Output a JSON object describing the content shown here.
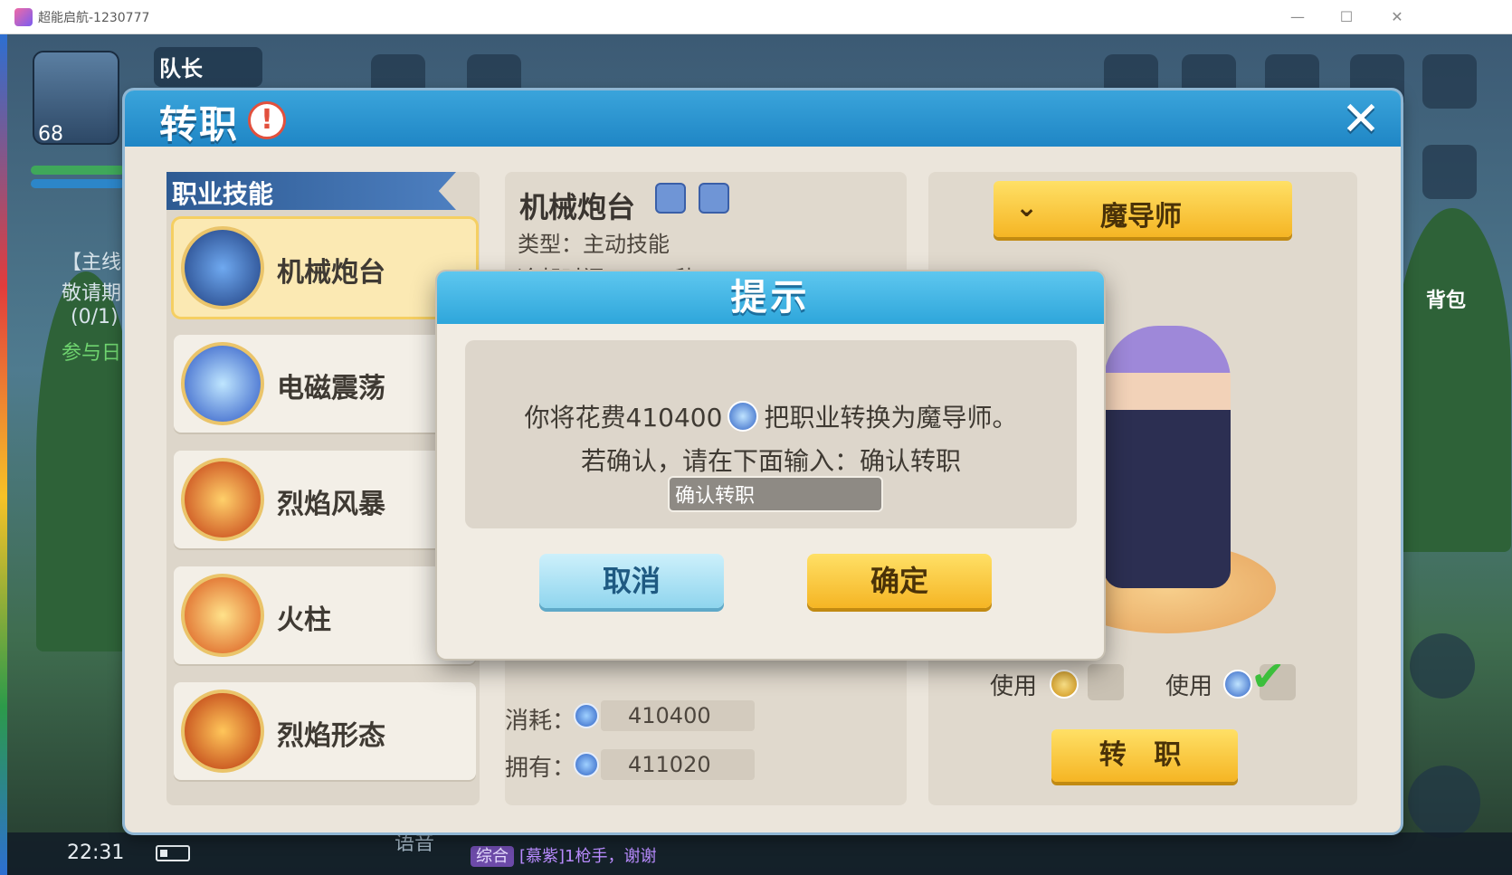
{
  "window": {
    "title": "超能启航-1230777",
    "minimize": "—",
    "maximize": "☐",
    "close": "✕"
  },
  "hud": {
    "level": "68",
    "captain_label": "队长",
    "quest_lines": [
      "【主线",
      "敬请期",
      "(0/1)",
      "参与日"
    ],
    "bag_label": "背包",
    "time": "22:31",
    "voice_label": "语音",
    "chat_tag": "综合",
    "chat_text": "[慕紫]1枪手，谢谢"
  },
  "dialog": {
    "title": "转职",
    "alert_symbol": "!",
    "close_symbol": "✕"
  },
  "skills": {
    "header": "职业技能",
    "items": [
      {
        "name": "机械炮台",
        "color": "#2b4f9e"
      },
      {
        "name": "电磁震荡",
        "color": "#3f6fd8"
      },
      {
        "name": "烈焰风暴",
        "color": "#d8561f"
      },
      {
        "name": "火柱",
        "color": "#e36a1a"
      },
      {
        "name": "烈焰形态",
        "color": "#cf4a12"
      }
    ]
  },
  "detail": {
    "name": "机械炮台",
    "type": "类型：主动技能",
    "cooldown": "冷却时间：20.0秒",
    "cost_label": "消耗：",
    "cost_value": "410400",
    "own_label": "拥有：",
    "own_value": "411020"
  },
  "right": {
    "class_name": "魔导师",
    "use_label_1": "使用",
    "use_label_2": "使用",
    "transfer_button": "转 职",
    "check_symbol": "✔"
  },
  "modal": {
    "title": "提示",
    "line1_prefix": "你将花费410400",
    "line1_suffix": "把职业转换为魔导师。",
    "line2": "若确认，请在下面输入：确认转职",
    "input_value": "确认转职",
    "cancel": "取消",
    "ok": "确定"
  },
  "colors": {
    "header_blue": "#1f86c5",
    "gold_button": "#f5b524",
    "panel_bg": "#ebe5db"
  }
}
